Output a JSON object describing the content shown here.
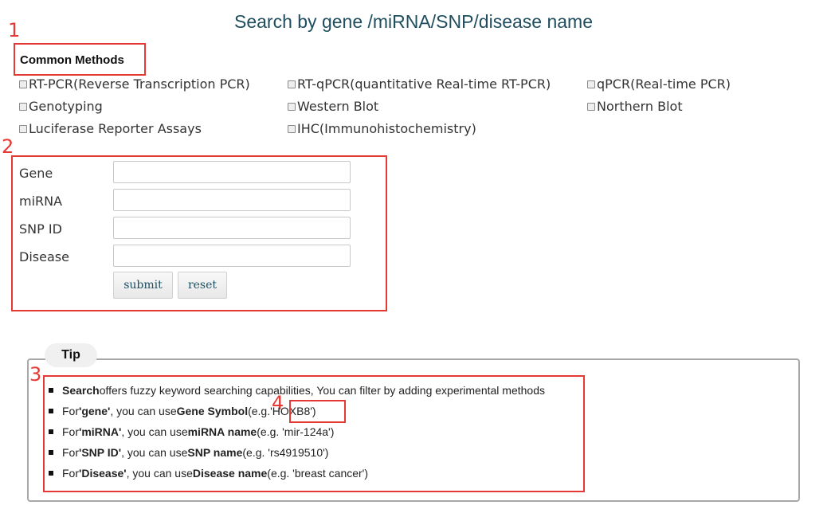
{
  "page": {
    "title": "Search by gene /miRNA/SNP/disease name"
  },
  "annotations": [
    "1",
    "2",
    "3",
    "4"
  ],
  "methods": {
    "heading": "Common Methods",
    "options": [
      "RT-PCR(Reverse Transcription PCR)",
      "RT-qPCR(quantitative Real-time RT-PCR)",
      "qPCR(Real-time PCR)",
      "Genotyping",
      "Western Blot",
      "Northern Blot",
      "Luciferase Reporter Assays",
      "IHC(Immunohistochemistry)"
    ]
  },
  "form": {
    "fields": [
      {
        "label": "Gene",
        "value": ""
      },
      {
        "label": "miRNA",
        "value": ""
      },
      {
        "label": "SNP ID",
        "value": ""
      },
      {
        "label": "Disease",
        "value": ""
      }
    ],
    "submit_label": "submit",
    "reset_label": "reset"
  },
  "tip": {
    "legend": "Tip",
    "line1": {
      "bold": "Search",
      "rest": " offers fuzzy keyword searching capabilities, You can filter by adding experimental methods"
    },
    "line2": {
      "pre": "For ",
      "field": "'gene'",
      "mid": ", you can use ",
      "kind": "Gene Symbol",
      "eg_open": " (e.g. ",
      "example": "'HOXB8'",
      "eg_close": ")"
    },
    "line3": {
      "pre": "For ",
      "field": "'miRNA'",
      "mid": ", you can use ",
      "kind": "miRNA name",
      "eg": " (e.g. 'mir-124a')"
    },
    "line4": {
      "pre": "For ",
      "field": "'SNP ID'",
      "mid": ", you can use ",
      "kind": "SNP name",
      "eg": " (e.g. 'rs4919510')"
    },
    "line5": {
      "pre": "For ",
      "field": "'Disease'",
      "mid": ", you can use ",
      "kind": "Disease name",
      "eg": " (e.g. 'breast cancer')"
    }
  }
}
